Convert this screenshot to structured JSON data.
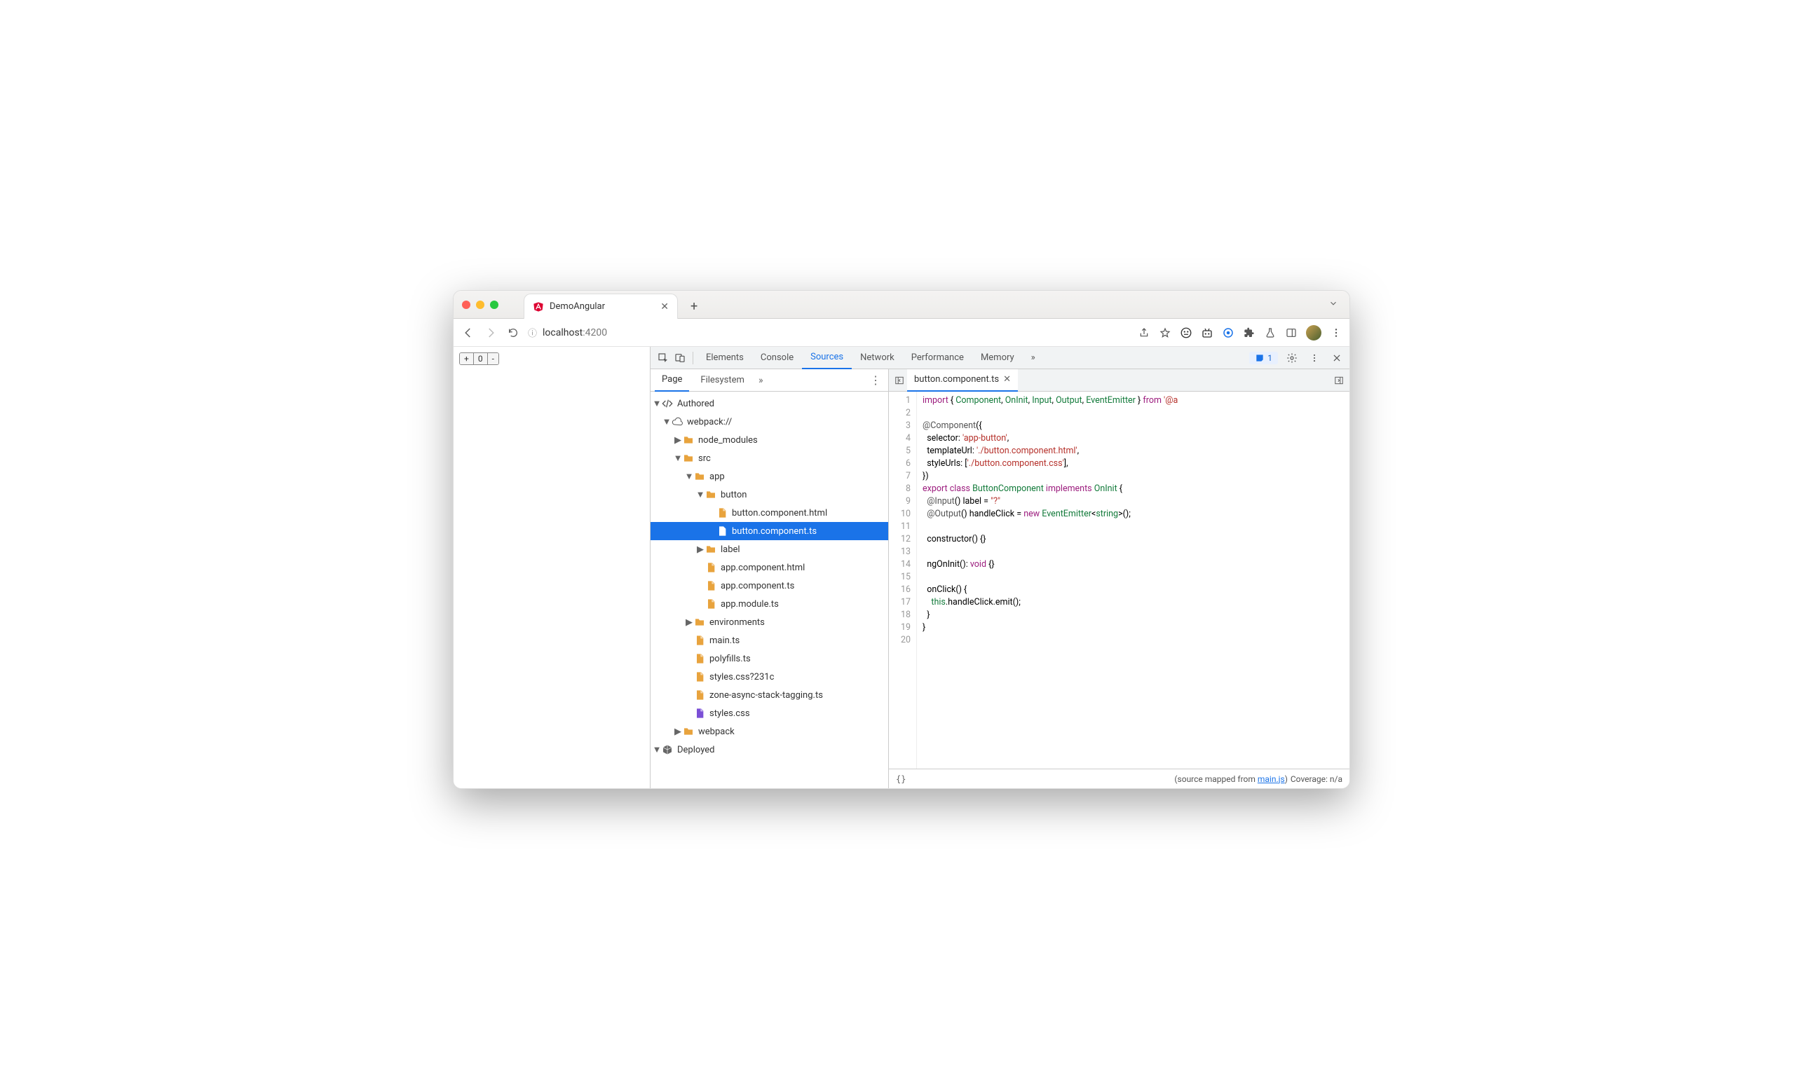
{
  "browser": {
    "tab_title": "DemoAngular",
    "url_info_icon": "ⓘ",
    "url_host": "localhost",
    "url_port": ":4200"
  },
  "page": {
    "plus_btn": "+",
    "zero_label": "0",
    "minus_btn": "-"
  },
  "devtools": {
    "tabs": [
      "Elements",
      "Console",
      "Sources",
      "Network",
      "Performance",
      "Memory"
    ],
    "active_tab": "Sources",
    "more_tabs": "»",
    "issues_count": "1"
  },
  "sources": {
    "page_tab": "Page",
    "filesystem_tab": "Filesystem",
    "more": "»",
    "tree": {
      "authored": "Authored",
      "webpack": "webpack://",
      "node_modules": "node_modules",
      "src": "src",
      "app": "app",
      "button": "button",
      "button_html": "button.component.html",
      "button_ts": "button.component.ts",
      "label": "label",
      "app_html": "app.component.html",
      "app_ts": "app.component.ts",
      "app_module": "app.module.ts",
      "environments": "environments",
      "main_ts": "main.ts",
      "polyfills": "polyfills.ts",
      "styles_q": "styles.css?231c",
      "zone": "zone-async-stack-tagging.ts",
      "styles_css": "styles.css",
      "webpack_folder": "webpack",
      "deployed": "Deployed"
    },
    "open_file": "button.component.ts"
  },
  "code": {
    "lines": 20
  },
  "status": {
    "mapped_prefix": "(source mapped from ",
    "mapped_link": "main.js",
    "mapped_suffix": ")",
    "coverage": "Coverage: n/a"
  }
}
